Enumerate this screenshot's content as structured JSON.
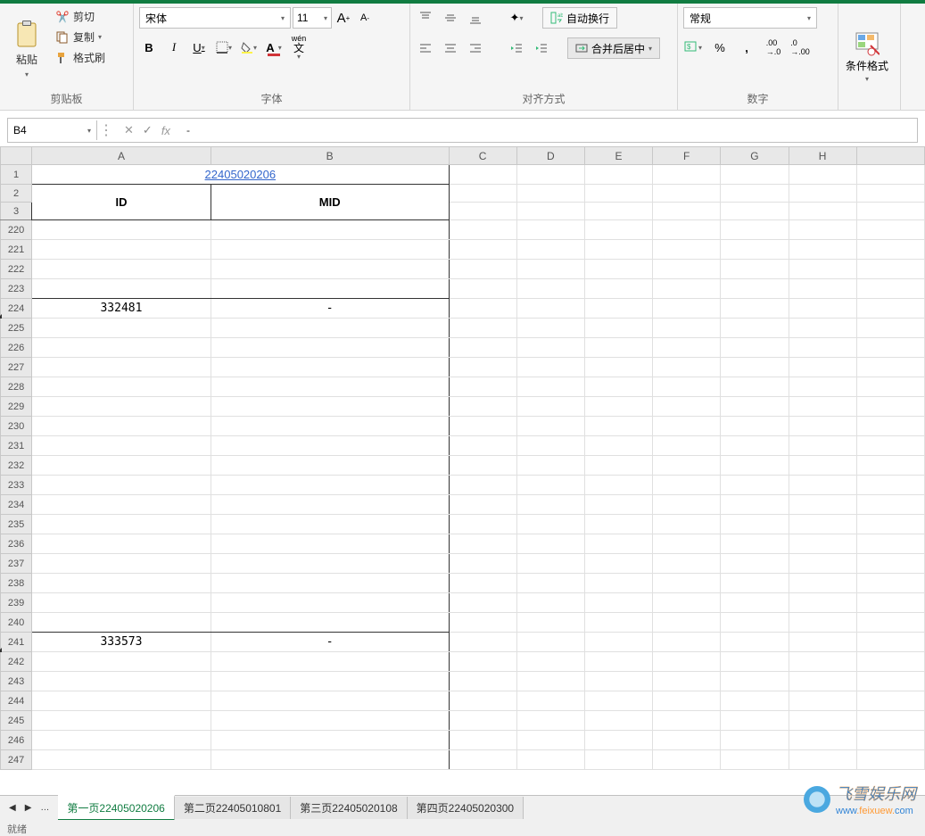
{
  "ribbon": {
    "clipboard": {
      "paste": "粘贴",
      "cut": "剪切",
      "copy": "复制",
      "format_painter": "格式刷",
      "label": "剪贴板"
    },
    "font": {
      "name": "宋体",
      "size": "11",
      "bold": "B",
      "italic": "I",
      "underline": "U",
      "pinyin": "wén",
      "inc": "A",
      "dec": "A",
      "label": "字体"
    },
    "align": {
      "wrap": "自动换行",
      "merge": "合并后居中",
      "label": "对齐方式"
    },
    "number": {
      "format": "常规",
      "label": "数字"
    },
    "cond_format": "条件格式"
  },
  "namebox": "B4",
  "formula_value": "-",
  "columns": [
    "A",
    "B",
    "C",
    "D",
    "E",
    "F",
    "G",
    "H"
  ],
  "link_title": "22405020206",
  "headers": {
    "id": "ID",
    "mid": "MID"
  },
  "rows_header": [
    "1",
    "2",
    "3"
  ],
  "rows_body": [
    "220",
    "221",
    "222",
    "223",
    "224",
    "225",
    "226",
    "227",
    "228",
    "229",
    "230",
    "231",
    "232",
    "233",
    "234",
    "235",
    "236",
    "237",
    "238",
    "239",
    "240",
    "241",
    "242",
    "243",
    "244",
    "245",
    "246",
    "247"
  ],
  "data": {
    "224": {
      "A": "332481",
      "B": "-"
    },
    "241": {
      "A": "333573",
      "B": "-"
    }
  },
  "tabs": {
    "active": "第一页22405020206",
    "others": [
      "第二页22405010801",
      "第三页22405020108",
      "第四页22405020300"
    ]
  },
  "status": "就绪",
  "watermark": {
    "brand": "飞雪娱乐网",
    "url_b": "www",
    "url_o": ".feixuew.",
    "url_b2": "com"
  }
}
